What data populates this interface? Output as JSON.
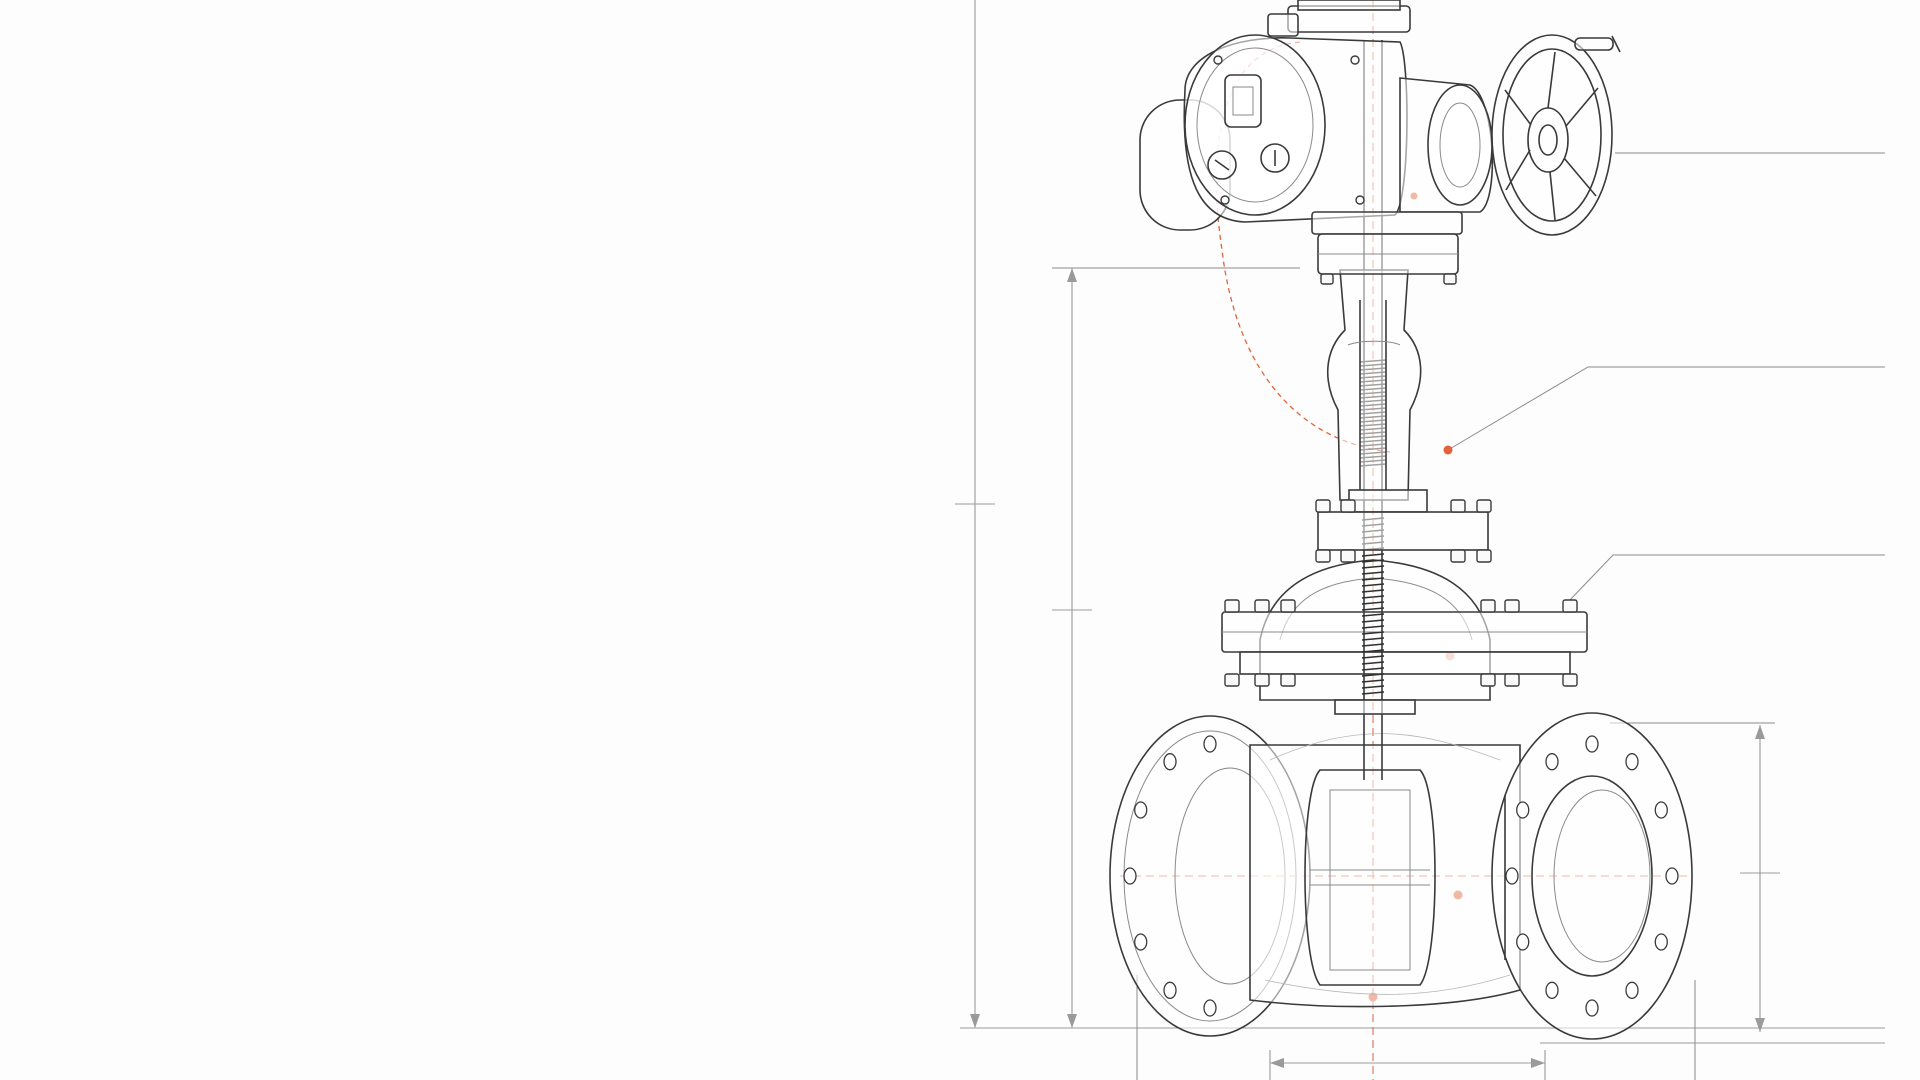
{
  "diagram": {
    "subject": "gate-valve-with-electric-actuator",
    "accent_color": "#e0633a",
    "line_color": "#3a3a3a",
    "background_color": "#fdfdfd",
    "callout_count": 5,
    "dimension_lines": 5,
    "labels": []
  }
}
